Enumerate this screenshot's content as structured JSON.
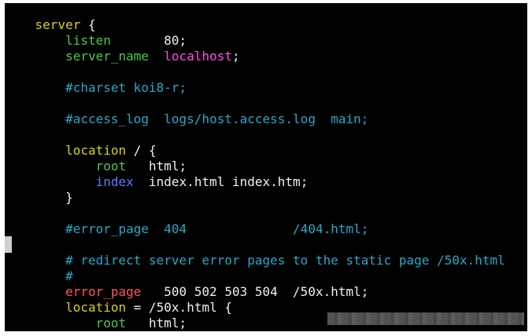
{
  "editor": {
    "lines": [
      {
        "parts": [
          {
            "t": "    "
          },
          {
            "t": "server",
            "c": "yellow"
          },
          {
            "t": " {",
            "c": "white"
          }
        ]
      },
      {
        "parts": [
          {
            "t": "        "
          },
          {
            "t": "listen",
            "c": "green"
          },
          {
            "t": "       80;",
            "c": "white"
          }
        ]
      },
      {
        "parts": [
          {
            "t": "        "
          },
          {
            "t": "server_name",
            "c": "green"
          },
          {
            "t": "  ",
            "c": "white"
          },
          {
            "t": "localhost",
            "c": "magenta"
          },
          {
            "t": ";",
            "c": "white"
          }
        ]
      },
      {
        "parts": [
          {
            "t": ""
          }
        ]
      },
      {
        "parts": [
          {
            "t": "        "
          },
          {
            "t": "#charset koi8-r;",
            "c": "cyan"
          }
        ]
      },
      {
        "parts": [
          {
            "t": ""
          }
        ]
      },
      {
        "parts": [
          {
            "t": "        "
          },
          {
            "t": "#access_log  logs/host.access.log  main;",
            "c": "cyan"
          }
        ]
      },
      {
        "parts": [
          {
            "t": ""
          }
        ]
      },
      {
        "parts": [
          {
            "t": "        "
          },
          {
            "t": "location",
            "c": "yellow"
          },
          {
            "t": " / {",
            "c": "white"
          }
        ]
      },
      {
        "parts": [
          {
            "t": "            "
          },
          {
            "t": "root",
            "c": "green"
          },
          {
            "t": "   html;",
            "c": "white"
          }
        ]
      },
      {
        "parts": [
          {
            "t": "            "
          },
          {
            "t": "index",
            "c": "blue"
          },
          {
            "t": "  index.html index.htm;",
            "c": "white"
          }
        ]
      },
      {
        "parts": [
          {
            "t": "        }",
            "c": "white"
          }
        ]
      },
      {
        "parts": [
          {
            "t": ""
          }
        ]
      },
      {
        "parts": [
          {
            "t": "        "
          },
          {
            "t": "#error_page  404              /404.html;",
            "c": "cyan"
          }
        ]
      },
      {
        "parts": [
          {
            "t": ""
          }
        ]
      },
      {
        "parts": [
          {
            "t": "        "
          },
          {
            "t": "# redirect server error pages to the static page /50x.html",
            "c": "cyan"
          }
        ]
      },
      {
        "parts": [
          {
            "t": "        "
          },
          {
            "t": "#",
            "c": "cyan"
          }
        ]
      },
      {
        "parts": [
          {
            "t": "        "
          },
          {
            "t": "error_page",
            "c": "red"
          },
          {
            "t": "   500 502 503 504  /50x.html;",
            "c": "white"
          }
        ]
      },
      {
        "parts": [
          {
            "t": "        "
          },
          {
            "t": "location",
            "c": "yellow"
          },
          {
            "t": " = /50x.html {",
            "c": "white"
          }
        ]
      },
      {
        "parts": [
          {
            "t": "            "
          },
          {
            "t": "root",
            "c": "green"
          },
          {
            "t": "   html;",
            "c": "white"
          }
        ]
      }
    ]
  }
}
